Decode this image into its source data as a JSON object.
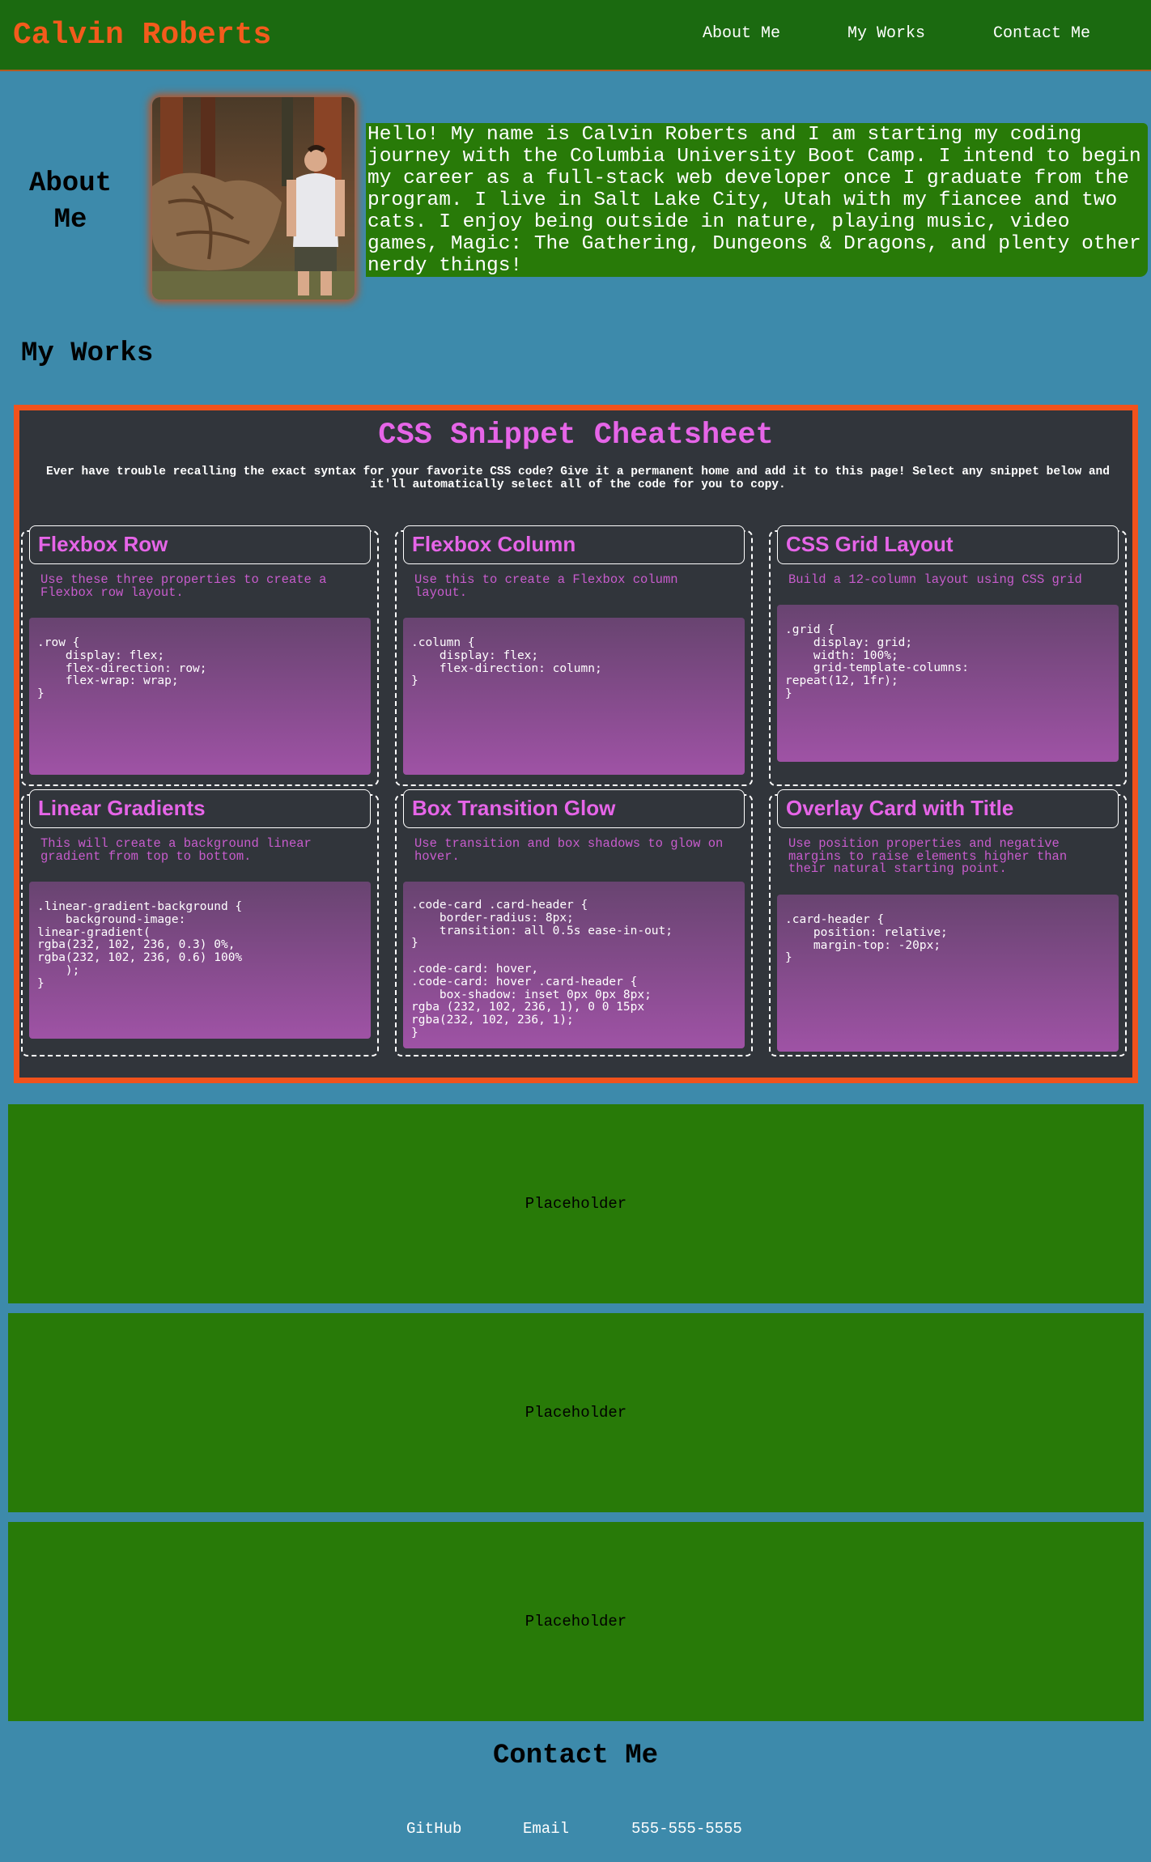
{
  "header": {
    "brand": "Calvin Roberts",
    "nav": [
      "About Me",
      "My Works",
      "Contact Me"
    ]
  },
  "about": {
    "heading_line1": "About",
    "heading_line2": "Me",
    "photo_alt": "Photo of Calvin Roberts",
    "text": "Hello! My name is Calvin Roberts and I am starting my coding journey with the Columbia University Boot Camp. I intend to begin my career as a full-stack web developer once I graduate from the program. I live in Salt Lake City, Utah with my fiancee and two cats. I enjoy being outside in nature, playing music, video games, Magic: The Gathering, Dungeons & Dragons, and plenty other nerdy things!"
  },
  "works": {
    "heading": "My Works",
    "cheatsheet": {
      "title": "CSS Snippet Cheatsheet",
      "description": "Ever have trouble recalling the exact syntax for your favorite CSS code? Give it a permanent home and add it to this page! Select any snippet below and it'll automatically select all of the code for you to copy.",
      "snippets": [
        {
          "title": "Flexbox Row",
          "desc": "Use these three properties to create a Flexbox row layout.",
          "code": ".row {\n    display: flex;\n    flex-direction: row;\n    flex-wrap: wrap;\n}"
        },
        {
          "title": "Flexbox Column",
          "desc": "Use this to create a Flexbox column layout.",
          "code": ".column {\n    display: flex;\n    flex-direction: column;\n}"
        },
        {
          "title": "CSS Grid Layout",
          "desc": "Build a 12-column layout using CSS grid",
          "code": ".grid {\n    display: grid;\n    width: 100%;\n    grid-template-columns:\nrepeat(12, 1fr);\n}"
        },
        {
          "title": "Linear Gradients",
          "desc": "This will create a background linear gradient from top to bottom.",
          "code": ".linear-gradient-background {\n    background-image:\nlinear-gradient(\nrgba(232, 102, 236, 0.3) 0%,\nrgba(232, 102, 236, 0.6) 100%\n    );\n}"
        },
        {
          "title": "Box Transition Glow",
          "desc": "Use transition and box shadows to glow on hover.",
          "code": ".code-card .card-header {\n    border-radius: 8px;\n    transition: all 0.5s ease-in-out;\n}\n\n.code-card: hover,\n.code-card: hover .card-header {\n    box-shadow: inset 0px 0px 8px;\nrgba (232, 102, 236, 1), 0 0 15px\nrgba(232, 102, 236, 1);\n}"
        },
        {
          "title": "Overlay Card with Title",
          "desc": "Use position properties and negative margins to raise elements higher than their natural starting point.",
          "code": ".card-header {\n    position: relative;\n    margin-top: -20px;\n}"
        }
      ]
    },
    "placeholders": [
      "Placeholder",
      "Placeholder",
      "Placeholder"
    ]
  },
  "contact": {
    "heading": "Contact Me",
    "links": [
      "GitHub",
      "Email",
      "555-555-5555"
    ]
  },
  "colors": {
    "page_bg": "#3d8aab",
    "header_bg": "#1b6a10",
    "brand": "#f35b1c",
    "panel_green": "#287a08",
    "sheet_bg": "#31353b",
    "sheet_border": "#f1521c",
    "accent_pink": "#e665e8"
  }
}
